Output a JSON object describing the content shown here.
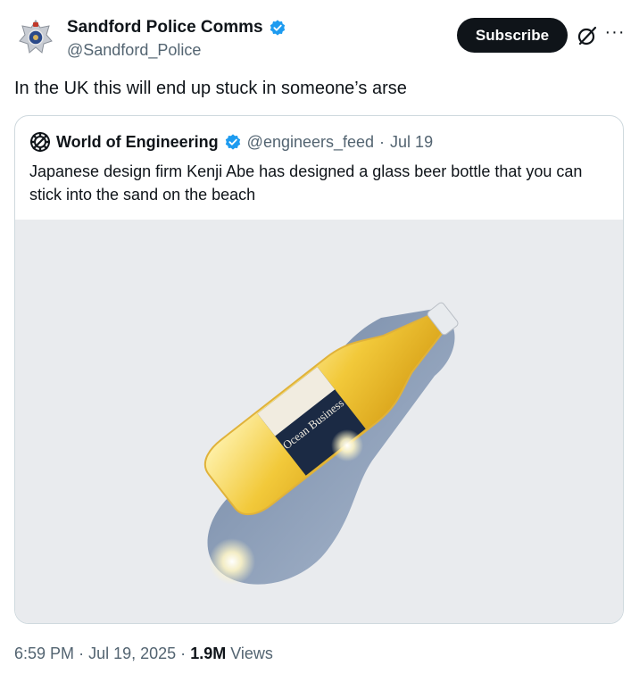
{
  "author": {
    "name": "Sandford Police Comms",
    "handle": "@Sandford_Police",
    "avatar_icon": "police-badge-icon",
    "verified_color": "#1d9bf0"
  },
  "actions": {
    "subscribe_label": "Subscribe",
    "grok_icon": "grok-icon",
    "more_label": "···"
  },
  "tweet": {
    "text": "In the UK this will end up stuck in someone’s arse"
  },
  "quote": {
    "name": "World of Engineering",
    "handle": "@engineers_feed",
    "separator": "·",
    "date": "Jul 19",
    "text": "Japanese design firm Kenji Abe has designed a glass beer bottle that you can stick into the sand on the beach",
    "media_description_icon": "beer-bottle-image",
    "bottle_label": "Ocean Business"
  },
  "footer": {
    "time": "6:59 PM",
    "sep1": "·",
    "date": "Jul 19, 2025",
    "sep2": "·",
    "views_count": "1.9M",
    "views_label": "Views"
  }
}
